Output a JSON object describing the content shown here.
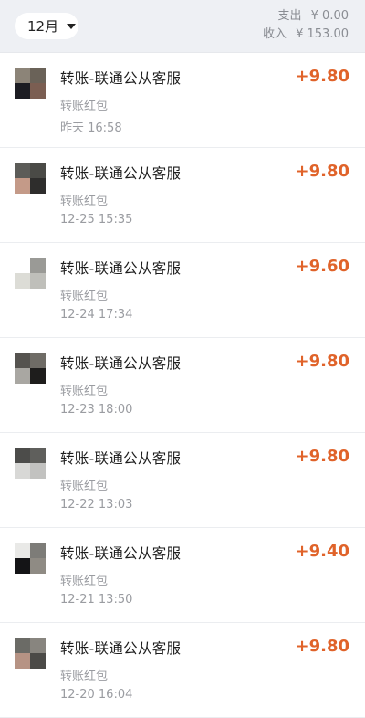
{
  "header": {
    "month": "12月",
    "expense_label": "支出",
    "expense_value": "¥ 0.00",
    "income_label": "收入",
    "income_value": "¥ 153.00"
  },
  "colors": {
    "amount": "#e0632a",
    "header_bg": "#eef0f4"
  },
  "transactions": [
    {
      "title": "转账-联通公从客服",
      "subtitle": "转账红包",
      "time": "昨天 16:58",
      "amount": "+9.80"
    },
    {
      "title": "转账-联通公从客服",
      "subtitle": "转账红包",
      "time": "12-25 15:35",
      "amount": "+9.80"
    },
    {
      "title": "转账-联通公从客服",
      "subtitle": "转账红包",
      "time": "12-24 17:34",
      "amount": "+9.60"
    },
    {
      "title": "转账-联通公从客服",
      "subtitle": "转账红包",
      "time": "12-23 18:00",
      "amount": "+9.80"
    },
    {
      "title": "转账-联通公从客服",
      "subtitle": "转账红包",
      "time": "12-22 13:03",
      "amount": "+9.80"
    },
    {
      "title": "转账-联通公从客服",
      "subtitle": "转账红包",
      "time": "12-21 13:50",
      "amount": "+9.40"
    },
    {
      "title": "转账-联通公从客服",
      "subtitle": "转账红包",
      "time": "12-20 16:04",
      "amount": "+9.80"
    }
  ]
}
